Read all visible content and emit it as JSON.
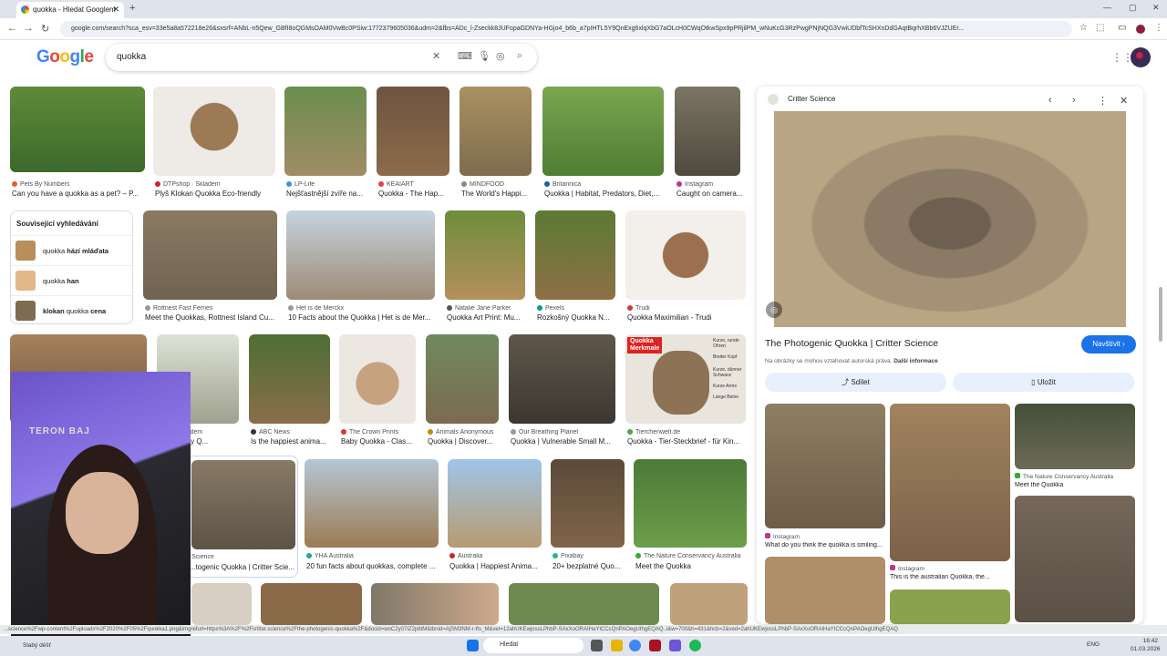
{
  "browser": {
    "tab_title": "quokka - Hledat Googlem",
    "url": "google.com/search?sca_esv=33e5a8a572218e26&sxsrf=ANbL-n5Qew_GBfI8oQGMsOAM0VwBc0PSiw:1772379605036&udm=2&fbs=ADc_l-Zseckk8JUFopaGDNYa-HGjo4_b6b_a7pIHTL5Y9QnExg6xlqXbG7aOLcH0CWqOtkwSpx9pPRjilPM_wNuKcG3RzPwgPNjNQG3VwiUDbfTcSHXnDdGAqtBqrhXBb6VJZUEr..."
  },
  "search": {
    "query": "quokka"
  },
  "row1": [
    {
      "src": "Pets By Numbers",
      "title": "Can you have a quokka as a pet? – P..."
    },
    {
      "src": "DTPshop · Skladem",
      "title": "Plyš Klokan Quokka Eco-friendly"
    },
    {
      "src": "LP-Life",
      "title": "Nejšťastnější zvíře na..."
    },
    {
      "src": "KEAIART",
      "title": "Quokka - The Hap..."
    },
    {
      "src": "MINDFOOD",
      "title": "The World's Happi..."
    },
    {
      "src": "Britannica",
      "title": "Quokka | Habitat, Predators, Diet,..."
    },
    {
      "src": "Instagram",
      "title": "Caught on camera..."
    }
  ],
  "related": {
    "heading": "Související vyhledávání",
    "items": [
      {
        "pre": "quokka ",
        "bold": "hází mláďata"
      },
      {
        "pre": "quokka ",
        "bold": "han"
      },
      {
        "bold": "klokan",
        "post": " quokka ",
        "bold2": "cena"
      }
    ]
  },
  "row2": [
    {
      "src": "Rottnest Fast Ferries",
      "title": "Meet the Quokkas, Rottnest Island Cu..."
    },
    {
      "src": "Het is de Merckx",
      "title": "10 Facts about the Quokka | Het is de Mer..."
    },
    {
      "src": "Natalie Jane Parker",
      "title": "Quokka Art Print: Mu..."
    },
    {
      "src": "Pexels",
      "title": "Rozkošný Quokka N..."
    },
    {
      "src": "Trudi",
      "title": "Quokka Maximilian - Trudi"
    }
  ],
  "row3": [
    {
      "src": "ABC News",
      "title": "Is the happiest anima..."
    },
    {
      "src": "The Crown Prints",
      "title": "Baby Quokka - Clas..."
    },
    {
      "src": "Animals Anonymous",
      "title": "Quokka | Discover..."
    },
    {
      "src": "Our Breathing Planet",
      "title": "Quokka | Vulnerable Small M..."
    },
    {
      "src": "Tierchenwelt.de",
      "title": "Quokka - Tier-Steckbrief - für Kin..."
    }
  ],
  "row3_partial": {
    "src": "...šík · Skladem",
    "title": "...ní figurky Q..."
  },
  "quokka_merkmale": {
    "header": "Quokka Merkmale",
    "labels": [
      "Kurze, runde Ohren",
      "Breiter Kopf",
      "Kurze, dünner Schwanz",
      "Kurze Arme",
      "Lange Beine"
    ]
  },
  "row4": [
    {
      "src": "Science",
      "title": "...togenic Quokka | Critter Scie..."
    },
    {
      "src": "YHA Australia",
      "title": "20 fun facts about quokkas, complete ..."
    },
    {
      "src": "Australia",
      "title": "Quokka | Happiest Anima..."
    },
    {
      "src": "Pixabay",
      "title": "20+ bezplatné Quo..."
    },
    {
      "src": "The Nature Conservancy Australia",
      "title": "Meet the Quokka"
    }
  ],
  "panel": {
    "site": "Critter Science",
    "title": "The Photogenic Quokka | Critter Science",
    "visit_label": "Navštívit",
    "note": "Na obrázky se mohou vztahovat autorská práva.",
    "note_link": "Další informace",
    "share_label": "Sdílet",
    "save_label": "Uložit",
    "related": [
      {
        "src": "Instagram",
        "title": "What do you think the quokka is smiling..."
      },
      {
        "src": "Instagram",
        "title": "This is the australian Quokka, the..."
      },
      {
        "src": "The Nature Conservancy Australia",
        "title": "Meet the Quokka"
      }
    ]
  },
  "status_url": "...science%2Fwp-content%2Fuploads%2F2020%2F05%2Fquokka1.png&imgrefurl=https%3A%2F%2Fcritter.science%2Fthe-photogenic-quokka%2F&docid=woC2y07IZ2p6tM&tbnid=AjSM3NM-r-fts_M&vet=12ahUKEwjossLPhbP-SAxXoORAIHaYICCcQnPAOegUIhgEQAQ..i&w=700&h=431&hcb=2&ved=2ahUKEwjossLPhbP-SAxXoORAIHaYICCcQnPAOegUIhgEQAQ",
  "webcam_text": "TERON BAJ",
  "taskbar": {
    "weather": "Slabý déšť",
    "search": "Hledat",
    "lang": "ENG",
    "time": "16:42",
    "date": "01.03.2026"
  }
}
